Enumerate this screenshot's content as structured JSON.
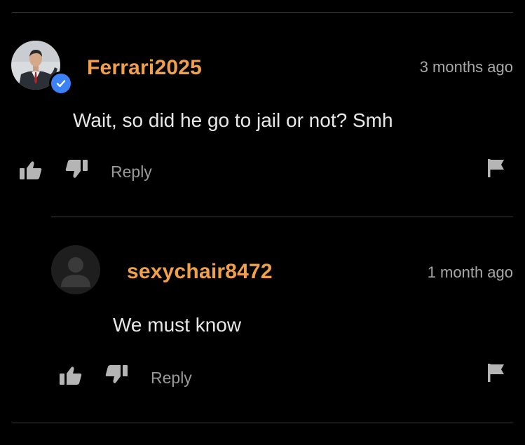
{
  "colors": {
    "background": "#000000",
    "username": "#f0a04b",
    "text": "#e8e8e8",
    "muted": "#9a9a9a",
    "verified_badge": "#3b82f6",
    "divider": "#3a3a3a"
  },
  "comments": [
    {
      "username": "Ferrari2025",
      "verified": true,
      "avatar": "profile-photo",
      "timestamp": "3 months ago",
      "text": "Wait, so did he go to jail or not? Smh",
      "actions": {
        "like_icon": "thumbs-up-icon",
        "dislike_icon": "thumbs-down-icon",
        "reply_label": "Reply",
        "flag_icon": "flag-icon"
      }
    },
    {
      "username": "sexychair8472",
      "verified": false,
      "avatar": "default-silhouette",
      "timestamp": "1 month ago",
      "text": "We must know",
      "actions": {
        "like_icon": "thumbs-up-icon",
        "dislike_icon": "thumbs-down-icon",
        "reply_label": "Reply",
        "flag_icon": "flag-icon"
      }
    }
  ]
}
